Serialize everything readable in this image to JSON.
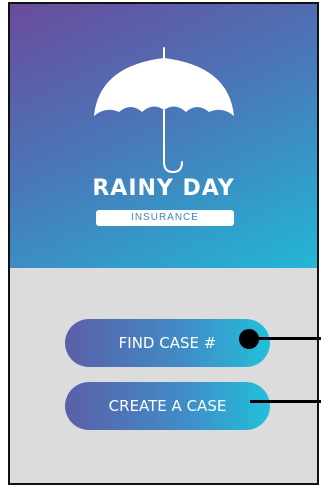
{
  "brand": {
    "name": "RAINY DAY",
    "tagline": "INSURANCE",
    "logo_icon": "umbrella-icon"
  },
  "actions": {
    "find_case_label": "FIND CASE #",
    "create_case_label": "CREATE A CASE"
  },
  "colors": {
    "gradient_start": "#6a4b9c",
    "gradient_end": "#22b7d6",
    "background": "#dcdcdc",
    "text_on_brand": "#ffffff"
  }
}
